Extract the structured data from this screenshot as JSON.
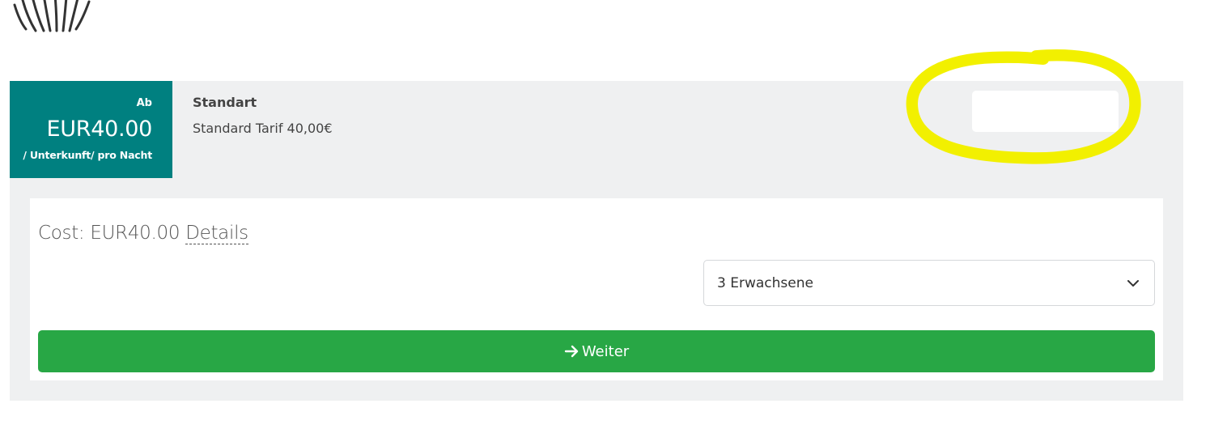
{
  "rate": {
    "price_prefix": "Ab",
    "price": "EUR40.00",
    "price_unit": "/ Unterkunft/ pro Nacht",
    "name": "Standart",
    "description": "Standard Tarif 40,00€"
  },
  "booking": {
    "cost_label": "Cost: EUR40.00",
    "details_label": "Details",
    "guests_selected": "3 Erwachsene",
    "continue_label": "Weiter"
  },
  "colors": {
    "price_box": "#008080",
    "continue_button": "#28a745",
    "highlight": "#f2f000",
    "card_background": "#eff0f1"
  },
  "icons": {
    "logo": "zebra-logo",
    "select_arrow": "chevron-down-icon",
    "continue": "arrow-right-icon"
  }
}
